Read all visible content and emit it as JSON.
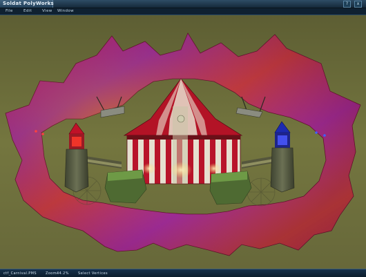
{
  "window": {
    "title": "Soldat PolyWorks",
    "help_button": "?",
    "close_button": "x"
  },
  "menu": {
    "items": [
      "File",
      "Edit",
      "View",
      "Window"
    ]
  },
  "status": {
    "file": "ctf_Carnival.PMS",
    "zoom_label": "Zoom:",
    "zoom_value": "44.2%",
    "mode": "Select Vertices"
  },
  "colors": {
    "background": "#6b6c3a",
    "accent": "#2e4d66"
  }
}
